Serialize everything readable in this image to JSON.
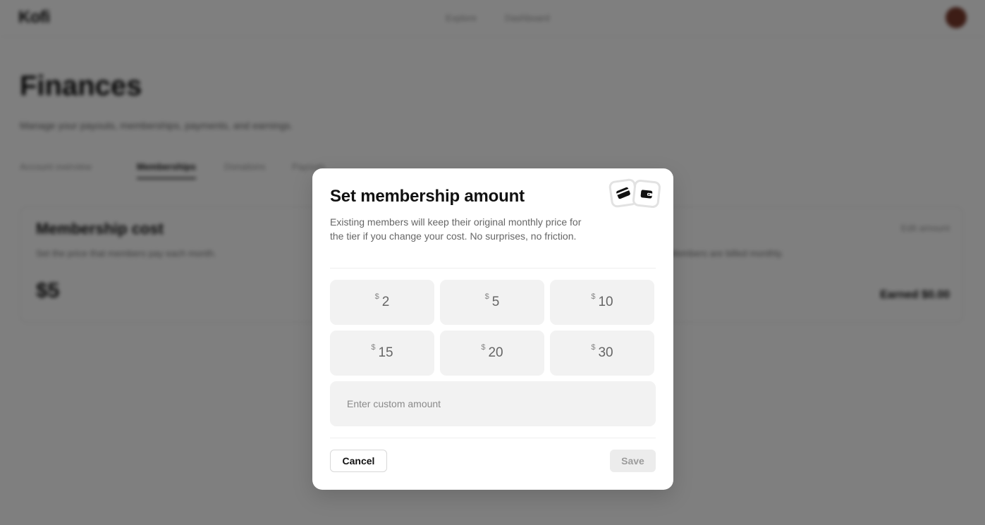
{
  "background": {
    "logo": "Kofi",
    "nav": [
      "Explore",
      "Dashboard"
    ],
    "page_title": "Finances",
    "page_subtitle": "Manage your payouts, memberships, payments, and earnings.",
    "tabs": [
      "Account overview",
      "Memberships",
      "Donations",
      "Payouts"
    ],
    "active_tab_index": 1,
    "card": {
      "title": "Membership cost",
      "description": "Set the price that members pay each month.",
      "description_right": "Members are billed monthly.",
      "amount": "$5",
      "edit_label": "Edit amount",
      "total_label": "Earned $0.00"
    }
  },
  "modal": {
    "title": "Set membership amount",
    "description": "Existing members will keep their original monthly price for the tier if you change your cost. No surprises, no friction.",
    "icons": [
      "credit-card-icon",
      "wallet-icon"
    ],
    "currency_symbol": "$",
    "amount_options": [
      "2",
      "5",
      "10",
      "15",
      "20",
      "30"
    ],
    "custom_amount": {
      "value": "",
      "placeholder": "Enter custom amount"
    },
    "cancel_label": "Cancel",
    "save_label": "Save",
    "save_enabled": false
  },
  "colors": {
    "overlay": "#808080",
    "modal_bg": "#ffffff",
    "option_bg": "#f2f2f2",
    "text_primary": "#111111",
    "text_muted": "#666666"
  }
}
